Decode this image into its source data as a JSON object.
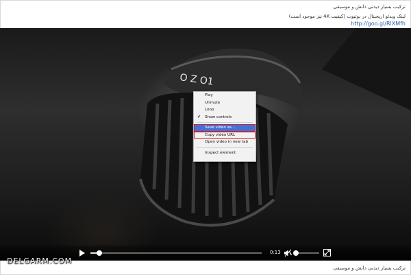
{
  "post": {
    "caption_top": "ترکیب بسیار دیدنی دانش و موسیقی",
    "description": "لینک ویدئو اریجینال در یوتیوب (کیفیت 4K نیز موجود است)",
    "link": "http://goo.gl/RlXMfh",
    "caption_bottom": "ترکیب بسیار دیدنی دانش و موسیقی"
  },
  "video": {
    "current_time": "0:13",
    "progress_fraction": 0.05,
    "volume_fraction": 0.0,
    "muted": true,
    "mic_label": "O Z O1"
  },
  "context_menu": {
    "items": [
      {
        "label": "Play"
      },
      {
        "label": "Unmute"
      },
      {
        "label": "Loop"
      },
      {
        "label": "Show controls",
        "checked": true
      },
      {
        "label": "Save video as...",
        "highlighted": true
      },
      {
        "label": "Copy video URL",
        "boxed": true
      },
      {
        "label": "Open video in new tab"
      },
      {
        "label": "Inspect element"
      }
    ]
  },
  "watermark": "DELGARM.COM",
  "colors": {
    "menu_highlight": "#3f73d9",
    "annotation_red": "#d01f2b",
    "link": "#2a5db0"
  }
}
